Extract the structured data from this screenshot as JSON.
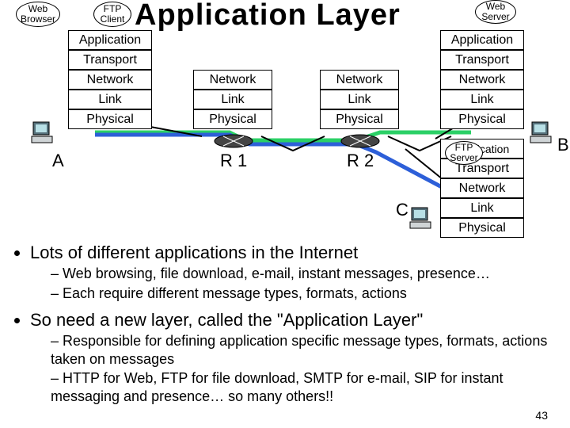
{
  "title": "Application Layer",
  "slide_number": "43",
  "stacks": {
    "hostA": [
      "Application",
      "Transport",
      "Network",
      "Link",
      "Physical"
    ],
    "r1": [
      "Network",
      "Link",
      "Physical"
    ],
    "r2": [
      "Network",
      "Link",
      "Physical"
    ],
    "hostB": [
      "Application",
      "Transport",
      "Network",
      "Link",
      "Physical"
    ],
    "hostC": [
      "Application",
      "Transport",
      "Network",
      "Link",
      "Physical"
    ]
  },
  "labels": {
    "A": "A",
    "B": "B",
    "C": "C",
    "R1": "R 1",
    "R2": "R 2"
  },
  "bubbles": {
    "web_browser": {
      "l1": "Web",
      "l2": "Browser"
    },
    "ftp_client": {
      "l1": "FTP",
      "l2": "Client"
    },
    "web_server": {
      "l1": "Web",
      "l2": "Server"
    },
    "ftp_server": {
      "l1": "FTP",
      "l2": "Server"
    }
  },
  "bullets": [
    {
      "text": "Lots of different applications in the Internet",
      "sub": [
        "Web browsing, file download, e-mail, instant messages, presence…",
        "Each require different message types, formats, actions"
      ]
    },
    {
      "text": "So need a new layer, called the \"Application Layer\"",
      "sub": [
        "Responsible for defining application specific message types, formats, actions taken on messages",
        "HTTP for Web, FTP for file download, SMTP for e-mail, SIP for instant messaging and presence… so many others!!"
      ]
    }
  ]
}
